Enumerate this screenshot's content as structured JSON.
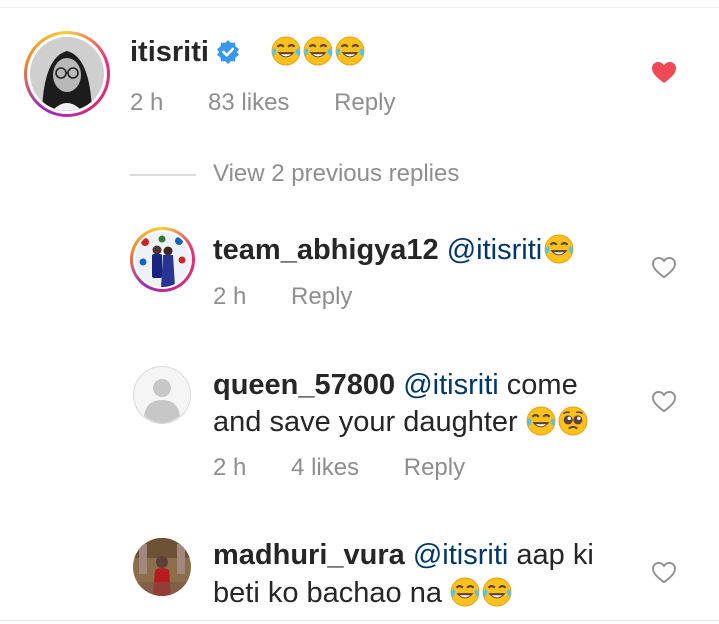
{
  "comment": {
    "username": "itisriti",
    "emojis": [
      "tears-of-joy-emoji",
      "tears-of-joy-emoji",
      "tears-of-joy-emoji"
    ],
    "time": "2 h",
    "likes": "83 likes",
    "reply_label": "Reply",
    "liked": true
  },
  "view_previous_label": "View 2 previous replies",
  "replies": [
    {
      "username": "team_abhigya12",
      "mention": "@itisriti",
      "text_line1": "",
      "text_line2": "",
      "time": "2 h",
      "likes": "",
      "reply_label": "Reply"
    },
    {
      "username": "queen_57800",
      "mention": "@itisriti",
      "text_line1": "come",
      "text_line2": "and save your daughter",
      "time": "2 h",
      "likes": "4 likes",
      "reply_label": "Reply"
    },
    {
      "username": "madhuri_vura",
      "mention": "@itisriti",
      "text_line1": "aap ki",
      "text_line2": "beti ko bachao na",
      "time": "",
      "likes": "",
      "reply_label": ""
    }
  ],
  "colors": {
    "liked_heart": "#ed4956",
    "mention": "#00376b",
    "meta_text": "#8e8e8e",
    "verified": "#3897f0"
  }
}
